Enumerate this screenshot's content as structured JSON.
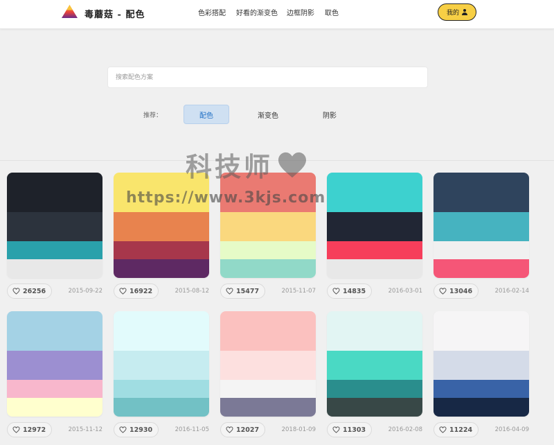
{
  "header": {
    "brand": "毒蘑菇 - 配色",
    "logo_icon": "mountain-logo",
    "nav": [
      "色彩搭配",
      "好看的渐变色",
      "边框阴影",
      "取色"
    ],
    "mine_label": "我的",
    "mine_icon": "user-icon"
  },
  "search": {
    "placeholder": "搜索配色方案",
    "value": ""
  },
  "recommend": {
    "label": "推荐：",
    "tabs": [
      "配色",
      "渐变色",
      "阴影"
    ],
    "active": "配色"
  },
  "watermark": {
    "line1": "科技师",
    "line2": "https://www.3kjs.com"
  },
  "palettes": [
    {
      "likes": "26256",
      "date": "2015-09-22",
      "colors": [
        "#1e222a",
        "#2c333d",
        "#2aa1ab",
        "#e8e8e8"
      ]
    },
    {
      "likes": "16922",
      "date": "2015-08-12",
      "colors": [
        "#f9e56c",
        "#e8834e",
        "#a7374b",
        "#5e2963"
      ]
    },
    {
      "likes": "15477",
      "date": "2015-11-07",
      "colors": [
        "#ea7a72",
        "#fad87e",
        "#e6fbc7",
        "#91d9c8"
      ]
    },
    {
      "likes": "14835",
      "date": "2016-03-01",
      "colors": [
        "#3dd1cf",
        "#212634",
        "#f63e5b",
        "#e8e8e8"
      ]
    },
    {
      "likes": "13046",
      "date": "2016-02-14",
      "colors": [
        "#2f445d",
        "#46b3c0",
        "#f0f0f0",
        "#f55677"
      ]
    },
    {
      "likes": "12972",
      "date": "2015-11-12",
      "colors": [
        "#a4d2e5",
        "#9c8fd1",
        "#f8b7cc",
        "#ffffce"
      ]
    },
    {
      "likes": "12930",
      "date": "2016-11-05",
      "colors": [
        "#e2fbfc",
        "#c6ecf0",
        "#a0dde2",
        "#72c1c5"
      ]
    },
    {
      "likes": "12027",
      "date": "2018-01-09",
      "colors": [
        "#fbc1bf",
        "#fde0df",
        "#f4f4f4",
        "#7b7996"
      ]
    },
    {
      "likes": "11303",
      "date": "2016-02-08",
      "colors": [
        "#e2f5f3",
        "#4ad9c4",
        "#2a8e8d",
        "#384847"
      ]
    },
    {
      "likes": "11224",
      "date": "2016-04-09",
      "colors": [
        "#f6f5f6",
        "#d4dbe8",
        "#3963a7",
        "#172845"
      ]
    }
  ]
}
